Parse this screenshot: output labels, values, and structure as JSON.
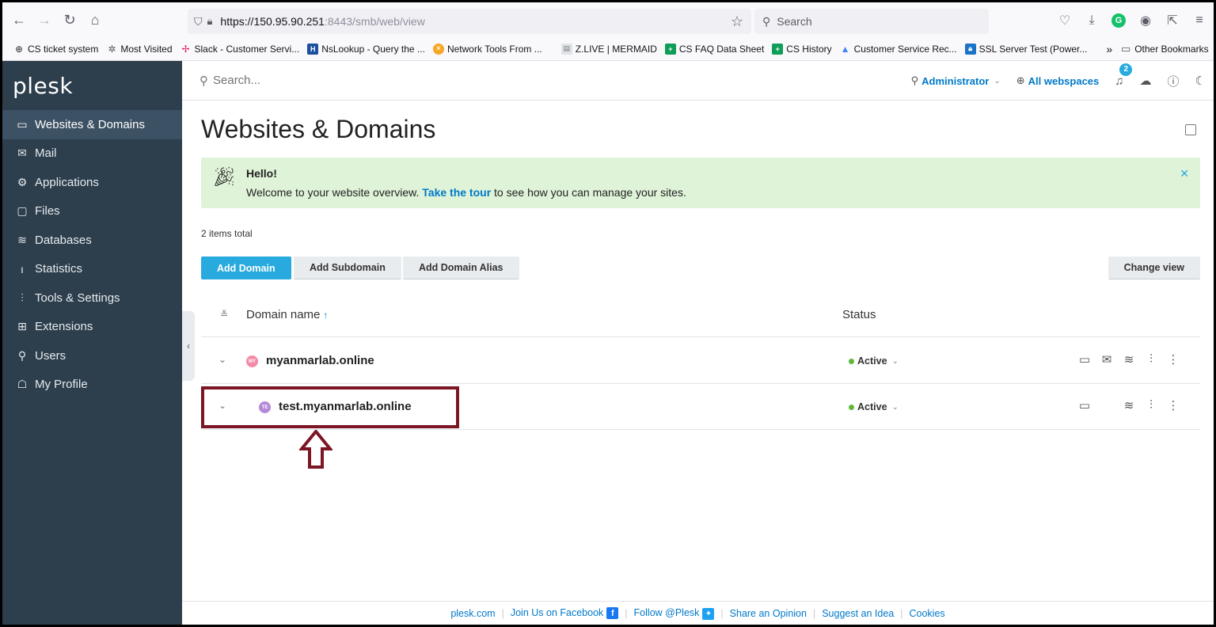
{
  "browser": {
    "url_main": "https://150.95.90.251",
    "url_rest": ":8443/smb/web/view",
    "search_placeholder": "Search",
    "bookmarks": [
      {
        "label": "CS ticket system",
        "color": "#555"
      },
      {
        "label": "Most Visited",
        "color": "#555"
      },
      {
        "label": "Slack - Customer Servi...",
        "color": "#e01e5a"
      },
      {
        "label": "NsLookup - Query the ...",
        "color": "#1b4fa0"
      },
      {
        "label": "Network Tools From ...",
        "color": "#f5a623"
      },
      {
        "label": "Z.LIVE | MERMAID",
        "color": "#9aa6b2"
      },
      {
        "label": "CS FAQ Data Sheet",
        "color": "#0f9d58"
      },
      {
        "label": "CS History",
        "color": "#0f9d58"
      },
      {
        "label": "Customer Service Rec...",
        "color": "#4285f4"
      },
      {
        "label": "SSL Server Test (Power...",
        "color": "#1a73c7"
      }
    ],
    "other_bookmarks": "Other Bookmarks"
  },
  "sidebar": {
    "logo": "plesk",
    "items": [
      {
        "label": "Websites & Domains",
        "icon": "monitor-icon",
        "glyph": "▭"
      },
      {
        "label": "Mail",
        "icon": "mail-icon",
        "glyph": "✉"
      },
      {
        "label": "Applications",
        "icon": "gear-icon",
        "glyph": "⚙"
      },
      {
        "label": "Files",
        "icon": "folder-icon",
        "glyph": "▢"
      },
      {
        "label": "Databases",
        "icon": "database-icon",
        "glyph": "≋"
      },
      {
        "label": "Statistics",
        "icon": "chart-icon",
        "glyph": "ı"
      },
      {
        "label": "Tools & Settings",
        "icon": "sliders-icon",
        "glyph": "⫶"
      },
      {
        "label": "Extensions",
        "icon": "extensions-icon",
        "glyph": "⊞"
      },
      {
        "label": "Users",
        "icon": "user-icon",
        "glyph": "⚲"
      },
      {
        "label": "My Profile",
        "icon": "profile-icon",
        "glyph": "☖"
      }
    ]
  },
  "header": {
    "search_placeholder": "Search...",
    "user": "Administrator",
    "webspaces": "All webspaces",
    "notifications_count": "2"
  },
  "main": {
    "title": "Websites & Domains",
    "welcome": {
      "title": "Hello!",
      "text_before": "Welcome to your website overview. ",
      "link": "Take the tour",
      "text_after": " to see how you can manage your sites."
    },
    "total": "2 items total",
    "buttons": {
      "add_domain": "Add Domain",
      "add_subdomain": "Add Subdomain",
      "add_alias": "Add Domain Alias",
      "change_view": "Change view"
    },
    "columns": {
      "name": "Domain name",
      "status": "Status"
    },
    "rows": [
      {
        "name": "myanmarlab.online",
        "avatar": "MY",
        "avatar_color": "#f58aa8",
        "status": "Active"
      },
      {
        "name": "test.myanmarlab.online",
        "avatar": "TE",
        "avatar_color": "#b48ad8",
        "status": "Active"
      }
    ]
  },
  "footer": {
    "links": [
      "plesk.com",
      "Join Us on Facebook",
      "Follow @Plesk",
      "Share an Opinion",
      "Suggest an Idea",
      "Cookies"
    ]
  }
}
